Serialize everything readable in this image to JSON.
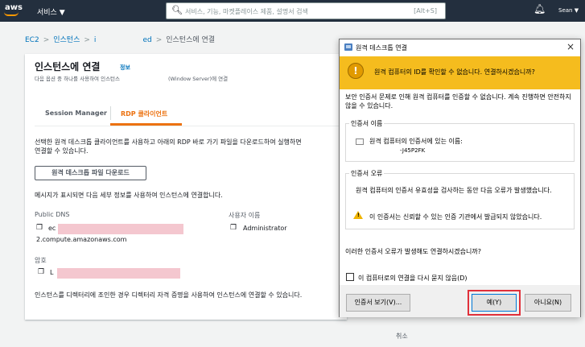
{
  "nav": {
    "logo": "aws",
    "services": "서비스 ▼",
    "search_placeholder": "서비스, 기능, 마켓플레이스 제품, 설명서 검색",
    "search_shortcut": "[Alt+S]",
    "user": "Sean ▼"
  },
  "breadcrumb": {
    "ec2": "EC2",
    "instances": "인스턴스",
    "instance_id": "i",
    "instance_id_tail": "ed",
    "current": "인스턴스에 연결"
  },
  "card": {
    "title": "인스턴스에 연결",
    "info": "정보",
    "subtitle_a": "다음 옵션 중 하나를 사용하여 인스턴스",
    "subtitle_b": "(Window Server)에 연결",
    "tabs": [
      "Session Manager",
      "RDP 클라이언트"
    ],
    "desc_line1": "선택한 원격 데스크톱 클라이언트를 사용하고 아래의 RDP 바로 가기 파일을 다운로드하여 실행하면",
    "desc_line2": "연결할 수 있습니다.",
    "download_button": "원격 데스크톱 파일 다운로드",
    "message": "메시지가 표시되면 다음 세부 정보를 사용하여 인스턴스에 연결합니다.",
    "public_dns_label": "Public DNS",
    "public_dns_prefix": "ec",
    "public_dns_suffix": "2.compute.amazonaws.com",
    "username_label": "사용자 이름",
    "username": "Administrator",
    "password_label": "암호",
    "password_prefix": "L",
    "footer": "인스턴스를 디렉터리에 조인한 경우 디렉터리 자격 증명을 사용하여 인스턴스에 연결할 수 있습니다."
  },
  "cancel": "취소",
  "dialog": {
    "title": "원격 데스크톱 연결",
    "close": "×",
    "banner": "원격 컴퓨터의 ID를 확인할 수 없습니다. 연결하시겠습니까?",
    "warn_glyph": "!",
    "intro": "보안 인증서 문제로 인해 원격 컴퓨터를 인증할 수 없습니다. 계속 진행하면 안전하지 않을 수 있습니다.",
    "cert_name_legend": "인증서 이름",
    "cert_name_label": "원격 컴퓨터의 인증서에 있는 이름:",
    "cert_name_value": "-J45P2FK",
    "cert_error_legend": "인증서 오류",
    "cert_error_desc": "원격 컴퓨터의 인증서 유효성을 검사하는 동안 다음 오류가 발생했습니다.",
    "cert_error_item": "이 인증서는 신뢰할 수 있는 인증 기관에서 발급되지 않았습니다.",
    "confirm_question": "이러한 인증서 오류가 발생해도 연결하시겠습니까?",
    "dont_ask": "이 컴퓨터로의 연결을 다시 묻지 않음(D)",
    "view_cert": "인증서 보기(V)...",
    "yes": "예(Y)",
    "no": "아니요(N)"
  },
  "colors": {
    "nav_bg": "#232f3e",
    "aws_orange": "#ec7211",
    "link": "#0073bb",
    "banner": "#f5bc1e",
    "highlight": "#e0303a",
    "redaction": "#f4c7cf"
  }
}
